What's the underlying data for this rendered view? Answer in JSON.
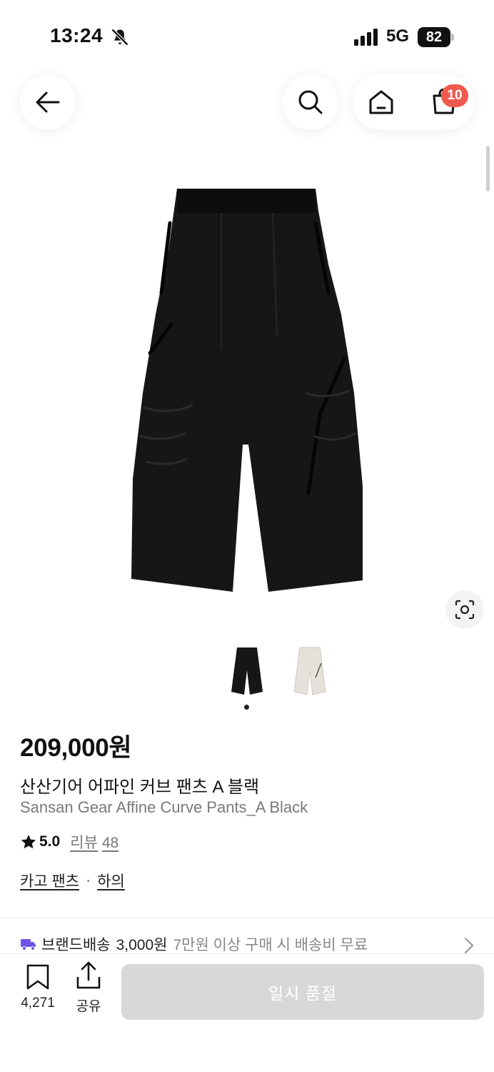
{
  "status_bar": {
    "time": "13:24",
    "network": "5G",
    "battery": "82",
    "icons": [
      "bell-slash-icon",
      "signal-icon",
      "battery-icon"
    ]
  },
  "header": {
    "cart_badge": "10",
    "icons": [
      "back-arrow-icon",
      "search-icon",
      "home-icon",
      "shopping-bag-icon"
    ]
  },
  "product": {
    "price": "209,000원",
    "name_ko": "산산기어 어파인 커브 팬츠 A 블랙",
    "name_en": "Sansan Gear Affine Curve Pants_A Black",
    "rating": "5.0",
    "review_label": "리뷰",
    "review_count": "48",
    "categories": [
      "카고 팬츠",
      "하의"
    ],
    "category_separator": "·",
    "thumbnails": [
      {
        "color_name": "black",
        "color": "#1a1a1a"
      },
      {
        "color_name": "white",
        "color": "#e6e1da"
      }
    ],
    "selected_thumbnail_index": 0
  },
  "shipping": {
    "brand_label": "브랜드배송",
    "fee": "3,000원",
    "note": "7만원 이상 구매 시 배송비 무료",
    "icon": "truck-icon",
    "accent": "#6f52e8"
  },
  "bottom_bar": {
    "bookmark_count": "4,271",
    "share_label": "공유",
    "soldout_label": "일시 품절"
  },
  "colors": {
    "badge": "#f0594d",
    "disabled_button": "#d8d8d8"
  }
}
